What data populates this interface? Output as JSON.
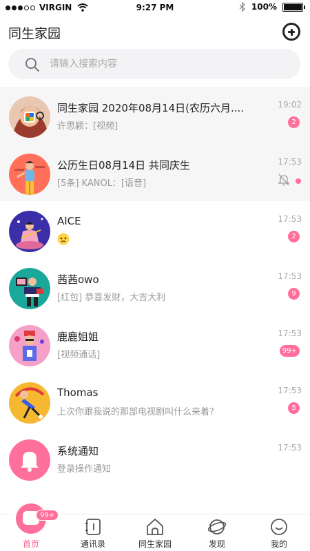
{
  "status_bar": {
    "carrier": "VIRGIN",
    "time": "9:27 PM",
    "battery": "100%",
    "battery_level": 1.0
  },
  "header": {
    "title": "同生家园",
    "add_icon": "plus-circle-icon"
  },
  "search": {
    "placeholder": "请输入搜索内容",
    "icon": "search-icon"
  },
  "conversations": [
    {
      "name": "同生家园 2020年08月14日(农历六月....",
      "message": "许思颖：[视频]",
      "time": "19:02",
      "badge": "2",
      "pinned": true
    },
    {
      "name": "公历生日08月14日 共同庆生",
      "message": "[5条] KANOL：[语音]",
      "time": "17:53",
      "muted": true,
      "pinned": true
    },
    {
      "name": "AICE",
      "message": "",
      "time": "17:53",
      "badge": "2",
      "emoji": "confused-face-emoji"
    },
    {
      "name": "茜茜owo",
      "message": "[红包] 恭喜发财，大吉大利",
      "time": "17:53",
      "badge": "9"
    },
    {
      "name": "鹿鹿姐姐",
      "message": "[视频通话]",
      "time": "17:53",
      "badge": "99+"
    },
    {
      "name": "Thomas",
      "message": "上次你跟我说的那部电视剧叫什么来着?",
      "time": "17:53",
      "badge": "5"
    },
    {
      "name": "系统通知",
      "message": "登录操作通知",
      "time": "17:53"
    }
  ],
  "tabbar": {
    "home_badge": "99+",
    "tabs": [
      {
        "label": "首页",
        "icon": "chat-bubble-icon",
        "active": true
      },
      {
        "label": "通讯录",
        "icon": "contacts-icon"
      },
      {
        "label": "同生家园",
        "icon": "house-icon"
      },
      {
        "label": "发现",
        "icon": "planet-icon"
      },
      {
        "label": "我的",
        "icon": "smile-face-icon"
      }
    ]
  },
  "colors": {
    "accent": "#ff6f9b",
    "badge": "#ff6f9b",
    "active_tab": "#ff5e8f"
  }
}
